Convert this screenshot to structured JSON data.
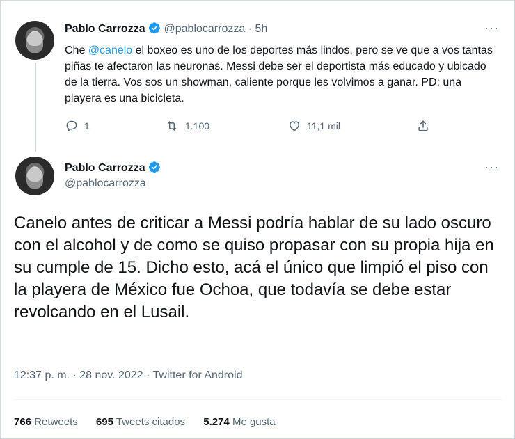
{
  "tweet1": {
    "name": "Pablo Carrozza",
    "handle": "@pablocarrozza",
    "time": "· 5h",
    "text_pre": "Che ",
    "mention": "@canelo",
    "text_post": " el boxeo es uno de los deportes más lindos, pero se ve que a vos tantas piñas te afectaron las neuronas. Messi debe ser el deportista más educado y ubicado de la tierra. Vos sos un showman, caliente porque les volvimos a ganar. PD: una playera es una bicicleta.",
    "replies": "1",
    "retweets": "1.100",
    "likes": "11,1 mil"
  },
  "tweet2": {
    "name": "Pablo Carrozza",
    "handle": "@pablocarrozza",
    "text": "Canelo antes de criticar a Messi podría hablar de su lado oscuro con el alcohol y de como se quiso propasar con su propia hija en su cumple de 15. Dicho esto, acá el único que limpió el piso con la playera de México fue Ochoa, que todavía se debe estar revolcando en el Lusail.",
    "meta": "12:37 p. m. · 28 nov. 2022 · Twitter for Android",
    "retweets_count": "766",
    "retweets_label": "Retweets",
    "quotes_count": "695",
    "quotes_label": "Tweets citados",
    "likes_count": "5.274",
    "likes_label": "Me gusta"
  },
  "colors": {
    "accent": "#1d9bf0",
    "muted": "#536471",
    "text": "#0f1419"
  },
  "icons": [
    "reply-icon",
    "retweet-icon",
    "like-icon",
    "share-icon",
    "verified-icon",
    "more-icon"
  ]
}
